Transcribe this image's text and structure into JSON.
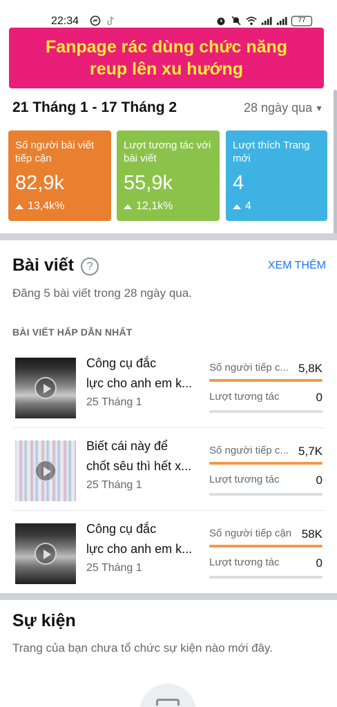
{
  "status_bar": {
    "time": "22:34",
    "battery": "77"
  },
  "overlay": {
    "line1": "Fanpage rác dùng chức năng",
    "line2": "reup lên xu hướng"
  },
  "header": {
    "date_range": "21 Tháng 1 - 17 Tháng 2",
    "period": "28 ngày qua"
  },
  "cards": [
    {
      "title": "Số người bài viết tiếp cận",
      "value": "82,9k",
      "change": "13,4k%",
      "color": "#e8802f"
    },
    {
      "title": "Lượt tương tác với bài viết",
      "value": "55,9k",
      "change": "12,1k%",
      "color": "#8bc34a"
    },
    {
      "title": "Lượt thích Trang mới",
      "value": "4",
      "change": "4",
      "color": "#3eb3e3"
    }
  ],
  "posts_section": {
    "title": "Bài viết",
    "help": "?",
    "see_more": "XEM THÊM",
    "summary": "Đăng 5 bài viết trong 28 ngày qua.",
    "top_label": "BÀI VIẾT HẤP DẪN NHẤT",
    "posts": [
      {
        "title_line1": "Công cụ đắc",
        "title_line2": "lực cho anh em k...",
        "date": "25 Tháng 1",
        "reach_label": "Số người tiếp c...",
        "reach_value": "5,8K",
        "reach_fill": 1.0,
        "engagement_label": "Lượt tương tác",
        "engagement_value": "0",
        "engagement_fill": 0
      },
      {
        "title_line1": "Biết cái này để",
        "title_line2": "chốt sêu thì hết x...",
        "date": "25 Tháng 1",
        "reach_label": "Số người tiếp c...",
        "reach_value": "5,7K",
        "reach_fill": 1.0,
        "engagement_label": "Lượt tương tác",
        "engagement_value": "0",
        "engagement_fill": 0
      },
      {
        "title_line1": "Công cụ đắc",
        "title_line2": "lực cho anh em k...",
        "date": "25 Tháng 1",
        "reach_label": "Số người tiếp cận",
        "reach_value": "58K",
        "reach_fill": 1.0,
        "engagement_label": "Lượt tương tác",
        "engagement_value": "0",
        "engagement_fill": 0
      }
    ]
  },
  "events_section": {
    "title": "Sự kiện",
    "summary": "Trang của bạn chưa tổ chức sự kiện nào mới đây."
  }
}
